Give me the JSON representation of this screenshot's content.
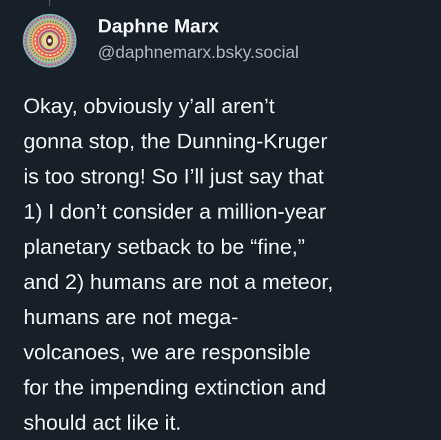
{
  "post": {
    "author": {
      "display_name": "Daphne Marx",
      "handle": "@daphnemarx.bsky.social",
      "avatar_icon": "mandala-avatar"
    },
    "body_lines": [
      "Okay, obviously y’all aren’t",
      "gonna stop, the Dunning-Kruger",
      "is too strong! So I’ll just say that",
      "1) I don’t consider a million-year",
      "planetary setback to be “fine,”",
      "and 2) humans are not a meteor,",
      "humans are not mega-",
      "volcanoes, we are responsible",
      "for the impending extinction and",
      "should act like it."
    ]
  },
  "colors": {
    "background": "#172029",
    "text_primary": "#f1f3f5",
    "text_secondary": "#aeb7c1"
  }
}
